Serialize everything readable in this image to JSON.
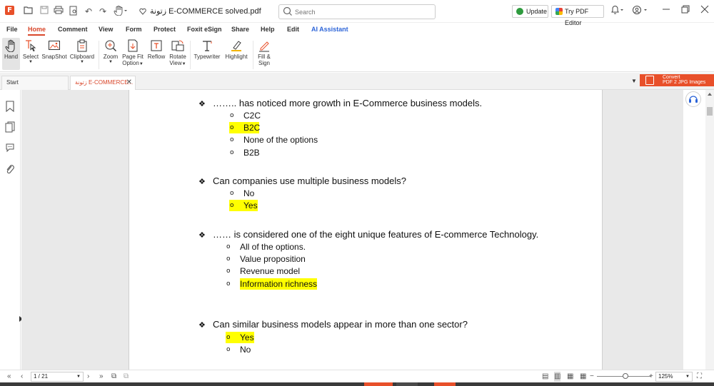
{
  "titlebar": {
    "doc_title": "زتونة E-COMMERCE solved.pdf",
    "search_placeholder": "Search",
    "update_label": "Update",
    "try_pdf_editor_label": "Try PDF Editor"
  },
  "menu": {
    "items": [
      "File",
      "Home",
      "Comment",
      "View",
      "Form",
      "Protect",
      "Foxit eSign",
      "Share",
      "Help",
      "Edit",
      "AI Assistant"
    ],
    "active": "Home"
  },
  "ribbon": {
    "hand": "Hand",
    "select": "Select",
    "snapshot": "SnapShot",
    "clipboard": "Clipboard",
    "zoom": "Zoom",
    "page_fit_1": "Page Fit",
    "page_fit_2": "Option",
    "reflow": "Reflow",
    "rotate_1": "Rotate",
    "rotate_2": "View",
    "typewriter": "Typewriter",
    "highlight": "Highlight",
    "fill_sign_1": "Fill &",
    "fill_sign_2": "Sign"
  },
  "tabs": {
    "start": "Start",
    "doc": "زتونة E-COMMERCE..."
  },
  "convert_banner": {
    "line1": "Convert",
    "line2": "PDF 2 JPG Images"
  },
  "document": {
    "questions": [
      {
        "text": "…….. has noticed more growth in E-Commerce business models.",
        "options": [
          {
            "text": "C2C",
            "highlighted": false
          },
          {
            "text": "B2C",
            "highlighted": true
          },
          {
            "text": "None of the options",
            "highlighted": false
          },
          {
            "text": "B2B",
            "highlighted": false
          }
        ]
      },
      {
        "text": "Can companies use multiple business models?",
        "options": [
          {
            "text": "No",
            "highlighted": false
          },
          {
            "text": "Yes",
            "highlighted": true
          }
        ]
      },
      {
        "text": "…… is considered one of the eight unique features of   E-commerce Technology.",
        "options": [
          {
            "text": "All of the options.",
            "highlighted": false
          },
          {
            "text": "Value proposition",
            "highlighted": false
          },
          {
            "text": "Revenue model",
            "highlighted": false
          },
          {
            "text": "Information richness",
            "highlighted": true
          }
        ]
      },
      {
        "text": "Can similar business models appear in more than one sector?",
        "options": [
          {
            "text": "Yes",
            "highlighted": true
          },
          {
            "text": "No",
            "highlighted": false
          }
        ]
      }
    ],
    "bullet_glyph": "❖",
    "option_glyph": "o"
  },
  "statusbar": {
    "page_indicator": "1 / 21",
    "zoom_level": "125%"
  },
  "colors": {
    "accent": "#d9472b",
    "ai": "#2c64d8",
    "highlight": "#ffff00",
    "convert_banner": "#e8502a"
  }
}
